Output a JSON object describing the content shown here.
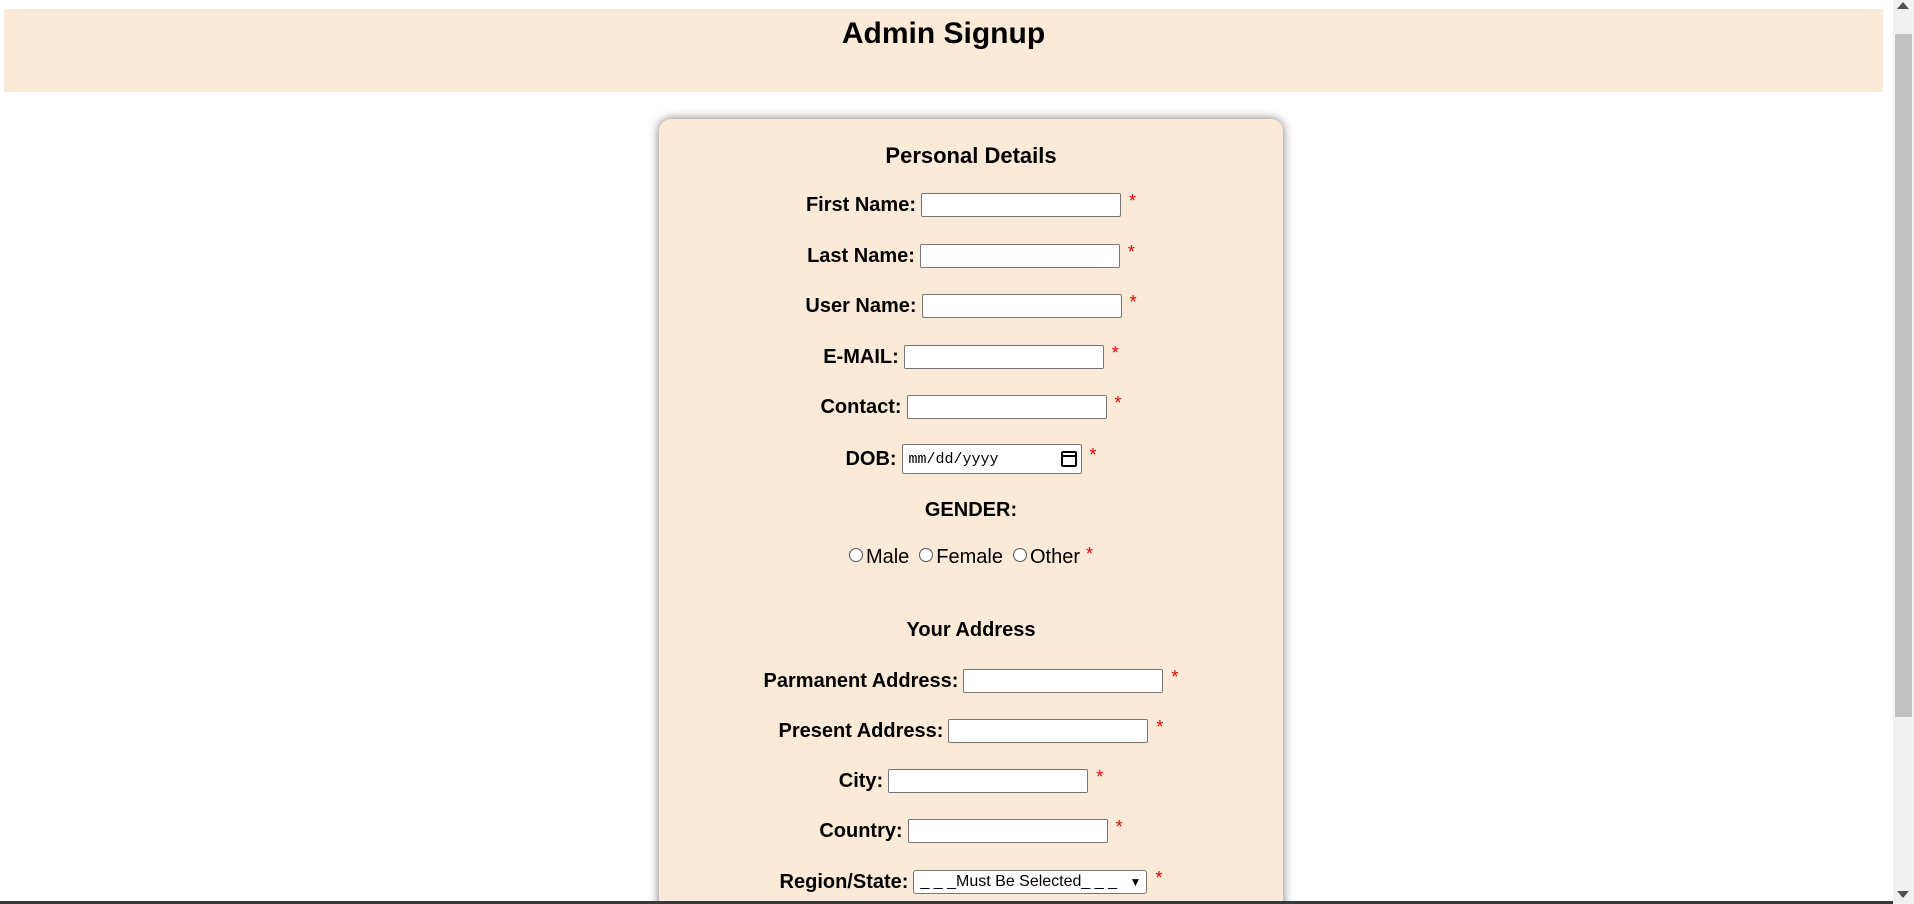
{
  "header": {
    "title": "Admin Signup"
  },
  "personal": {
    "section_title": "Personal Details",
    "first_name_label": "First Name:",
    "last_name_label": "Last Name:",
    "user_name_label": "User Name:",
    "email_label": "E-MAIL:",
    "contact_label": "Contact:",
    "dob_label": "DOB:",
    "dob_placeholder": "mm/dd/yyyy",
    "gender_label": "GENDER:",
    "gender_options": [
      "Male",
      "Female",
      "Other"
    ],
    "required_mark": "*"
  },
  "address": {
    "section_title": "Your Address",
    "permanent_label": "Parmanent Address:",
    "present_label": "Present Address:",
    "city_label": "City:",
    "country_label": "Country:",
    "region_label": "Region/State:",
    "region_selected": "_ _ _Must Be Selected_ _ _"
  },
  "colors": {
    "panel_background": "#faead7",
    "required": "#e00000"
  },
  "icons": {
    "dob": "calendar-icon",
    "select": "chevron-down-icon"
  }
}
